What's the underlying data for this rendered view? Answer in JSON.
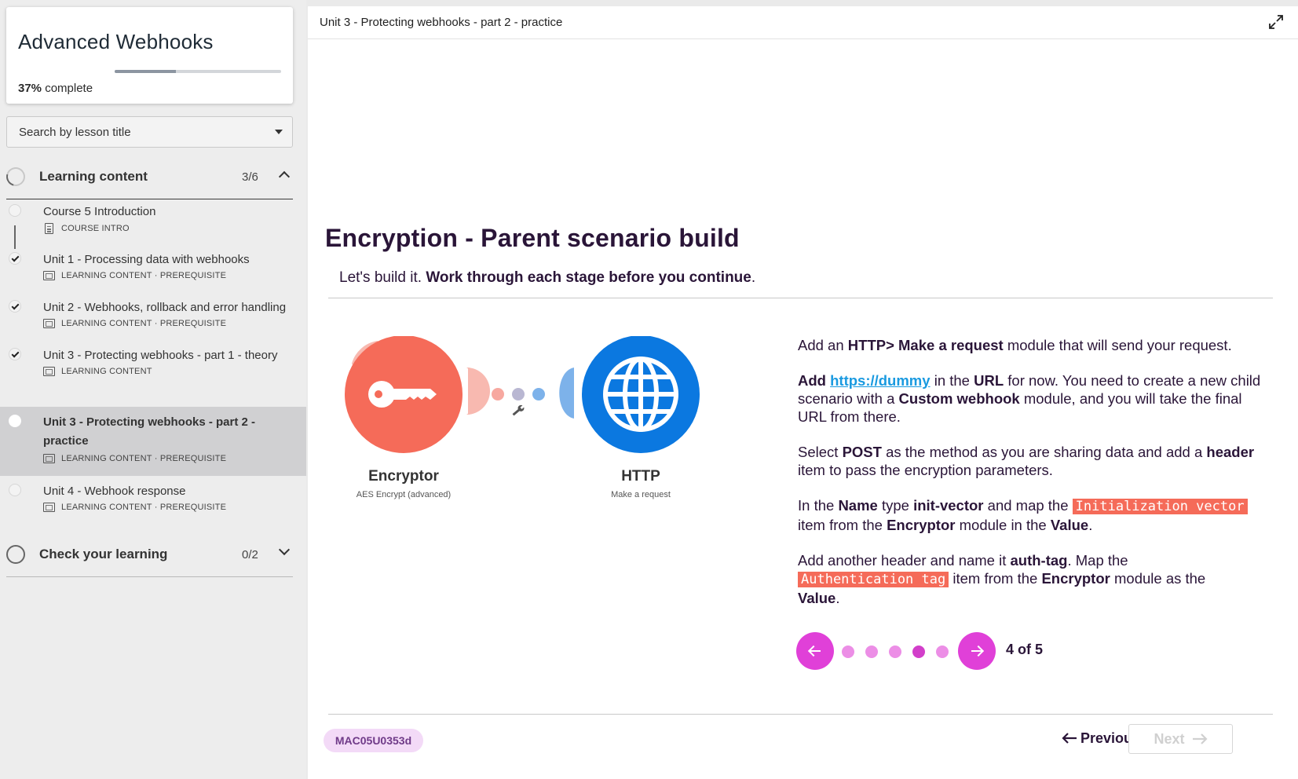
{
  "sidebar": {
    "course_title": "Advanced Webhooks",
    "progress_percent": 37,
    "progress_value": "37%",
    "progress_suffix": " complete",
    "search": {
      "label": "Search by lesson title"
    },
    "sections": [
      {
        "title": "Learning content",
        "count": "3/6",
        "expanded": true
      },
      {
        "title": "Check your learning",
        "count": "0/2",
        "expanded": false
      }
    ],
    "lessons": [
      {
        "title": "Course 5 Introduction",
        "meta": "COURSE INTRO",
        "done": false,
        "icon": "document-icon"
      },
      {
        "title": "Unit 1 - Processing data with webhooks",
        "meta": "LEARNING CONTENT · PREREQUISITE",
        "done": true,
        "icon": "slides-icon"
      },
      {
        "title": "Unit 2 - Webhooks, rollback and error handling",
        "meta": "LEARNING CONTENT · PREREQUISITE",
        "done": true,
        "icon": "slides-icon"
      },
      {
        "title": "Unit 3 - Protecting webhooks - part 1 - theory",
        "meta": "LEARNING CONTENT",
        "done": true,
        "icon": "slides-icon"
      },
      {
        "title": "Unit 3 - Protecting webhooks - part 2 - practice",
        "meta": "LEARNING CONTENT · PREREQUISITE",
        "done": false,
        "active": true,
        "icon": "slides-icon"
      },
      {
        "title": "Unit 4 - Webhook response",
        "meta": "LEARNING CONTENT · PREREQUISITE",
        "done": false,
        "icon": "slides-icon"
      }
    ]
  },
  "main": {
    "topbar_title": "Unit 3 - Protecting webhooks - part 2 - practice",
    "heading": "Encryption - Parent scenario build",
    "intro_plain": "Let's build it. ",
    "intro_bold": "Work through each stage before you continue",
    "intro_end": ".",
    "diagram": {
      "modules": [
        {
          "name": "Encryptor",
          "sub": "AES Encrypt (advanced)",
          "color": "#f56b59",
          "icon": "key-icon"
        },
        {
          "name": "HTTP",
          "sub": "Make a request",
          "color": "#0b78e0",
          "icon": "globe-icon"
        }
      ],
      "connector_icon": "wrench-icon"
    },
    "instructions": {
      "p1": {
        "t1": "Add an ",
        "b1": "HTTP> Make a request",
        "t2": " module that will send your request."
      },
      "p2": {
        "b1": "Add",
        "link": "https://dummy",
        "t1": " in the ",
        "b2": "URL",
        "t2": " for now.  You need to create a new child scenario with a ",
        "b3": "Custom webhook",
        "t3": " module, and you will take the final URL from there."
      },
      "p3": {
        "t1": "Select ",
        "b1": "POST",
        "t2": " as the method as you are sharing data and add a ",
        "b2": "header",
        "t3": " item to pass the encryption parameters."
      },
      "p4": {
        "t1": "In the ",
        "b1": "Name",
        "t2": " type ",
        "b2": "init-vector",
        "t3": " and map the ",
        "code": "Initialization vector",
        "t4": " item from the ",
        "b3": "Encryptor",
        "t5": " module in the ",
        "b4": "Value",
        "t6": "."
      },
      "p5": {
        "t1": "Add another header and name it ",
        "b1": "auth-tag",
        "t2": ". Map the ",
        "code": "Authentication tag",
        "t3": " item from the ",
        "b2": "Encryptor",
        "t4": " module as the ",
        "b3": "Value",
        "t5": "."
      }
    },
    "stepper": {
      "current": 4,
      "total": 5,
      "label": "4 of 5"
    },
    "footer": {
      "code": "MAC05U0353d",
      "previous": "Previous",
      "next": "Next"
    }
  },
  "colors": {
    "accent": "#e040d8",
    "heading": "#2a1538",
    "code_bg": "#f56b59",
    "link": "#1a9ae0",
    "badge_bg": "#f3daf7"
  }
}
